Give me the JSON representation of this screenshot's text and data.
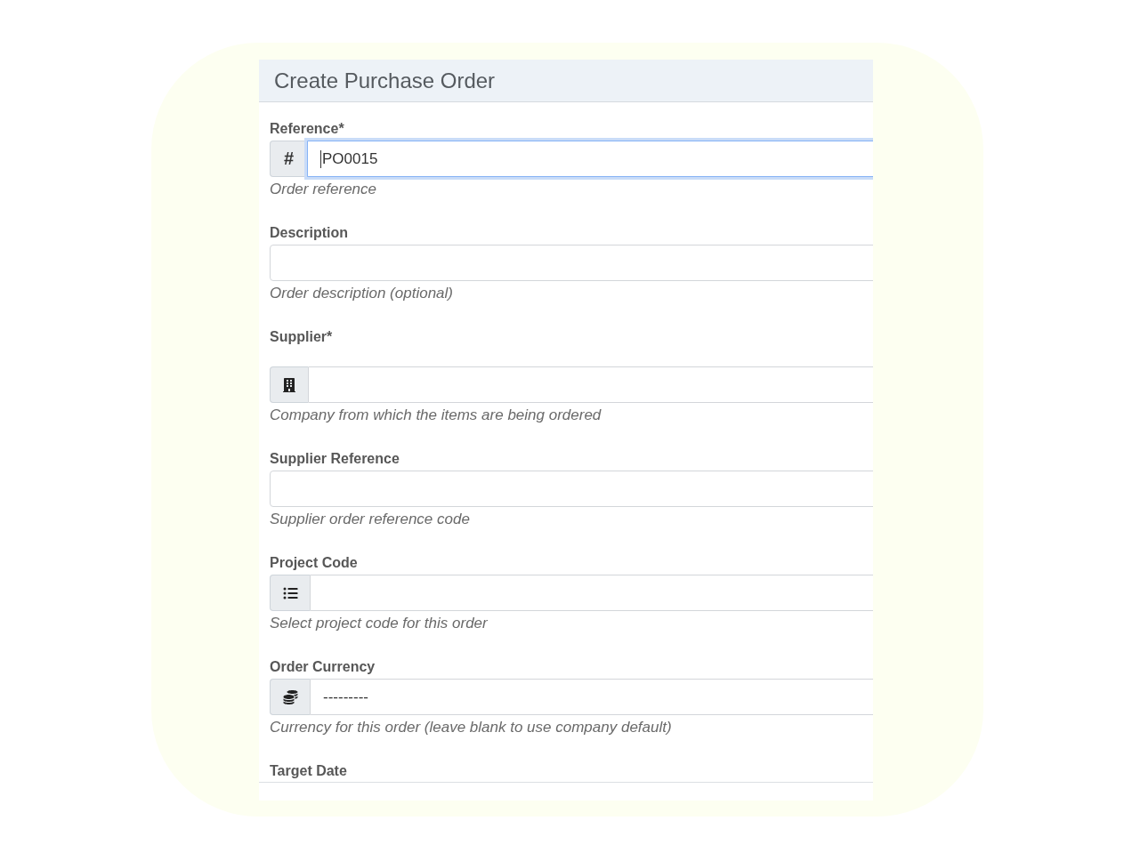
{
  "form": {
    "title": "Create Purchase Order",
    "fields": [
      {
        "kind": "reference",
        "label": "Reference*",
        "prefix": "#",
        "value": "PO0015",
        "focused": true,
        "help": "Order reference"
      },
      {
        "kind": "text",
        "label": "Description",
        "focused": false,
        "help": "Order description (optional)"
      },
      {
        "kind": "supplier",
        "label": "Supplier*",
        "focused": false,
        "help": "Company from which the items are being ordered"
      },
      {
        "kind": "text",
        "label": "Supplier Reference",
        "focused": false,
        "help": "Supplier order reference code"
      },
      {
        "kind": "project",
        "label": "Project Code",
        "focused": false,
        "help": "Select project code for this order"
      },
      {
        "kind": "currency",
        "label": "Order Currency",
        "value": "---------",
        "focused": false,
        "help": "Currency for this order (leave blank to use company default)"
      },
      {
        "kind": "date",
        "label": "Target Date"
      }
    ]
  }
}
